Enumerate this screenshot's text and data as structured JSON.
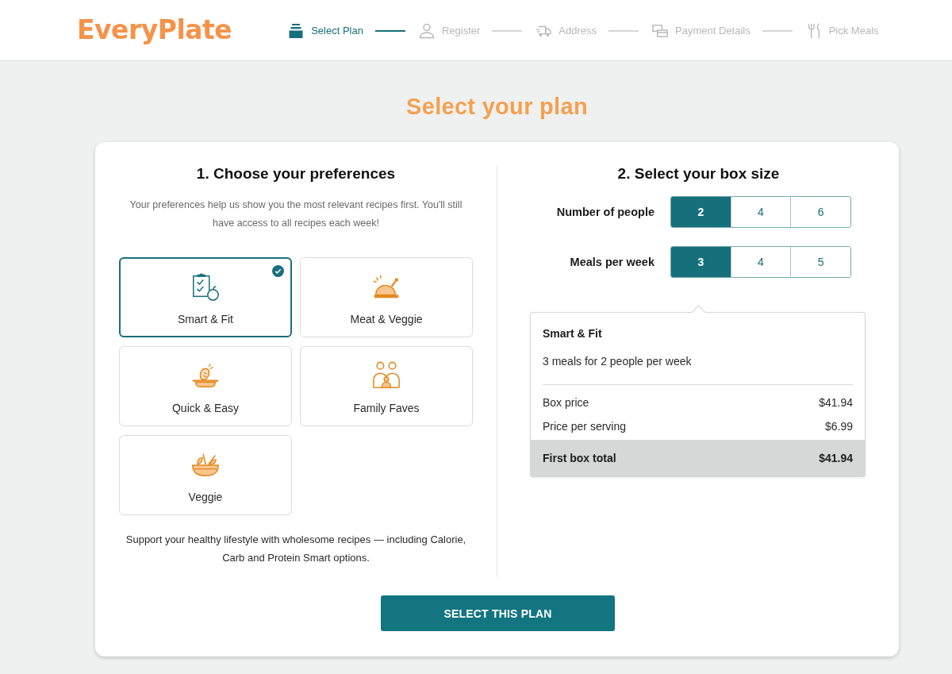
{
  "header": {
    "logo": "EveryPlate",
    "steps": [
      {
        "label": "Select Plan",
        "selected": true
      },
      {
        "label": "Register",
        "selected": false
      },
      {
        "label": "Address",
        "selected": false
      },
      {
        "label": "Payment Details",
        "selected": false
      },
      {
        "label": "Pick Meals",
        "selected": false
      }
    ]
  },
  "title": "Select your plan",
  "preferences": {
    "heading": "1. Choose your preferences",
    "description": "Your preferences help us show you the most relevant recipes first. You'll still have access to all recipes each week!",
    "options": [
      {
        "label": "Smart & Fit",
        "selected": true
      },
      {
        "label": "Meat & Veggie",
        "selected": false
      },
      {
        "label": "Quick & Easy",
        "selected": false
      },
      {
        "label": "Family Faves",
        "selected": false
      },
      {
        "label": "Veggie",
        "selected": false
      }
    ],
    "note": "Support your healthy lifestyle with wholesome recipes — including Calorie, Carb and Protein Smart options."
  },
  "box_size": {
    "heading": "2. Select your box size",
    "selectors": [
      {
        "label": "Number of people",
        "options": [
          {
            "label": "2",
            "selected": true
          },
          {
            "label": "4",
            "selected": false
          },
          {
            "label": "6",
            "selected": false
          }
        ]
      },
      {
        "label": "Meals per week",
        "options": [
          {
            "label": "3",
            "selected": true
          },
          {
            "label": "4",
            "selected": false
          },
          {
            "label": "5",
            "selected": false
          }
        ]
      }
    ],
    "summary": {
      "plan": "Smart & Fit",
      "detail": "3 meals for 2 people per week",
      "lines": [
        {
          "label": "Box price",
          "value": "$41.94"
        },
        {
          "label": "Price per serving",
          "value": "$6.99"
        }
      ],
      "total": {
        "label": "First box total",
        "value": "$41.94"
      }
    }
  },
  "button": "SELECT THIS PLAN"
}
